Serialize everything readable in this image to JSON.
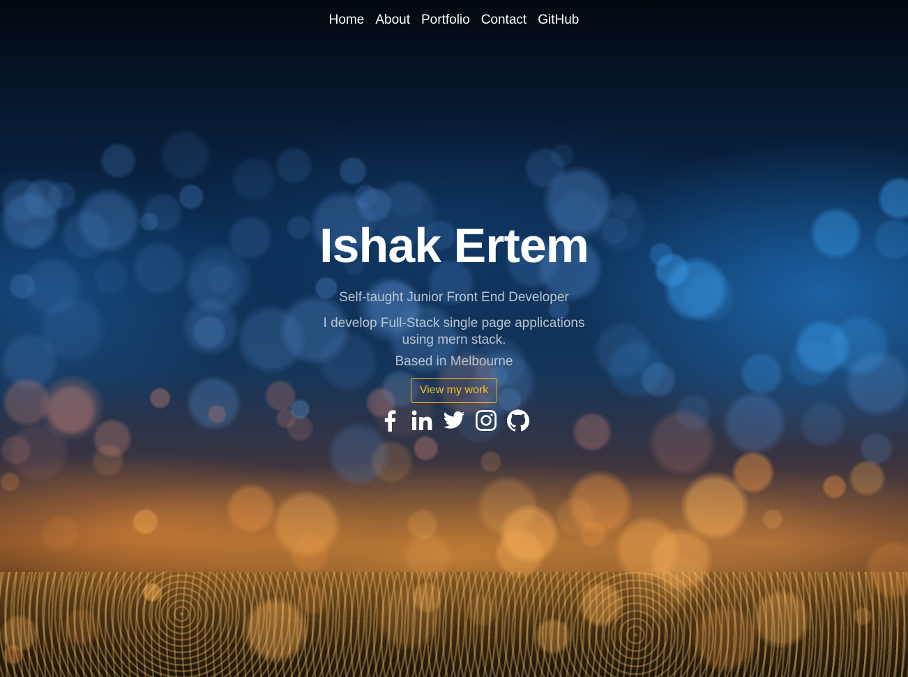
{
  "nav": {
    "items": [
      {
        "label": "Home"
      },
      {
        "label": "About"
      },
      {
        "label": "Portfolio"
      },
      {
        "label": "Contact"
      },
      {
        "label": "GitHub"
      }
    ]
  },
  "hero": {
    "name": "Ishak Ertem",
    "subtitle": "Self-taught Junior Front End Developer",
    "description": "I develop Full-Stack single page applications using mern stack.",
    "location": "Based in Melbourne",
    "cta_label": "View my work"
  },
  "socials": [
    {
      "icon": "facebook-icon"
    },
    {
      "icon": "linkedin-icon"
    },
    {
      "icon": "twitter-icon"
    },
    {
      "icon": "instagram-icon"
    },
    {
      "icon": "github-icon"
    }
  ],
  "colors": {
    "accent": "#f0c030",
    "text_muted": "#b8c3cf",
    "text_main": "#ffffff"
  }
}
